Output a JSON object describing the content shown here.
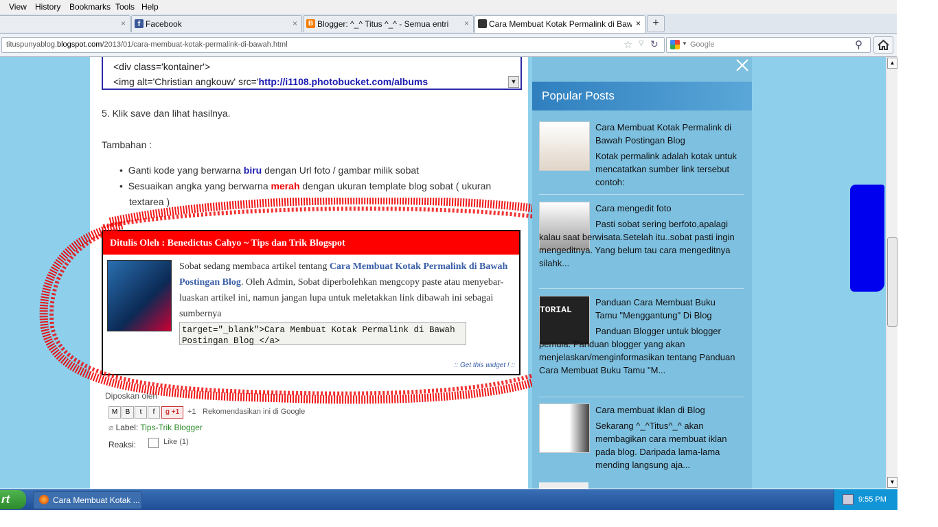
{
  "menu": [
    "View",
    "History",
    "Bookmarks",
    "Tools",
    "Help"
  ],
  "tabs": [
    {
      "label": "",
      "close": "×"
    },
    {
      "label": "Facebook",
      "close": "×"
    },
    {
      "label": "Blogger: ^_^ Titus ^_^ - Semua entri",
      "close": "×"
    },
    {
      "label": "Cara Membuat Kotak Permalink di Bawah ...",
      "close": "×"
    }
  ],
  "new_tab": "+",
  "url": {
    "prefix": "tituspunyablog.",
    "domain": "blogspot.com",
    "path": "/2013/01/cara-membuat-kotak-permalink-di-bawah.html"
  },
  "search": {
    "placeholder": "Google"
  },
  "post": {
    "code_line1": "<div class='kontainer'>",
    "code_line2_prefix": "<img alt='Christian angkouw' src='",
    "code_line2_link": "http://i1108.photobucket.com/albums",
    "step5": "5. Klik save dan lihat hasilnya.",
    "tambahan": "Tambahan :",
    "bullet1_a": "Ganti kode yang berwarna ",
    "bullet1_b": "biru",
    "bullet1_c": " dengan Url foto / gambar milik sobat",
    "bullet2_a": "Sesuaikan angka yang berwarna ",
    "bullet2_b": "merah",
    "bullet2_c": " dengan ukuran template blog sobat ( ukuran",
    "bullet2_d": "textarea )",
    "widget_title": "Ditulis Oleh : Benedictus Cahyo ~ Tips dan Trik Blogspot",
    "widget_text_a": "Sobat sedang membaca artikel tentang ",
    "widget_link": "Cara Membuat Kotak Permalink di Bawah Postingan Blog",
    "widget_text_b": ". Oleh Admin, Sobat diperbolehkan mengcopy paste atau menyebar-luaskan artikel ini, namun jangan lupa untuk meletakkan link dibawah ini sebagai sumbernya",
    "widget_code": "target=\"_blank\">Cara Membuat Kotak Permalink di Bawah Postingan Blog </a>",
    "widget_footer": ":: Get this widget ! ::",
    "posted_by": "Diposkan oleh",
    "share_plus": "+1",
    "share_plus_text": "Rekomendasikan ini di Google",
    "label_prefix": "Label: ",
    "label_link": "Tips-Trik Blogger",
    "reaksi": "Reaksi:",
    "like": "Like (1)"
  },
  "sidebar": {
    "popular_title": "Popular Posts",
    "posts": [
      {
        "title": "Cara Membuat Kotak Permalink di Bawah Postingan Blog",
        "snippet": "Kotak permalink adalah kotak untuk mencatatkan sumber link tersebut contoh:"
      },
      {
        "title": "Cara mengedit foto",
        "snippet": " Pasti sobat sering berfoto,apalagi kalau saat berwisata.Setelah itu..sobat pasti ingin mengeditnya. Yang belum tau cara mengeditnya silahk..."
      },
      {
        "title": "Panduan Cara Membuat Buku Tamu \"Menggantung\" Di Blog",
        "snippet": "Panduan Blogger untuk blogger pemula. Panduan blogger yang akan menjelaskan/menginformasikan tentang Panduan Cara Membuat Buku Tamu \"M..."
      },
      {
        "title": "Cara membuat iklan di Blog",
        "snippet": "Sekarang ^_^Titus^_^ akan membagikan cara membuat iklan pada blog. Daripada lama-lama mending langsung aja..."
      }
    ],
    "thumb3_text": "TORIAL"
  },
  "taskbar": {
    "start": "rt",
    "task": "Cara Membuat Kotak ...",
    "clock": "9:55 PM"
  }
}
